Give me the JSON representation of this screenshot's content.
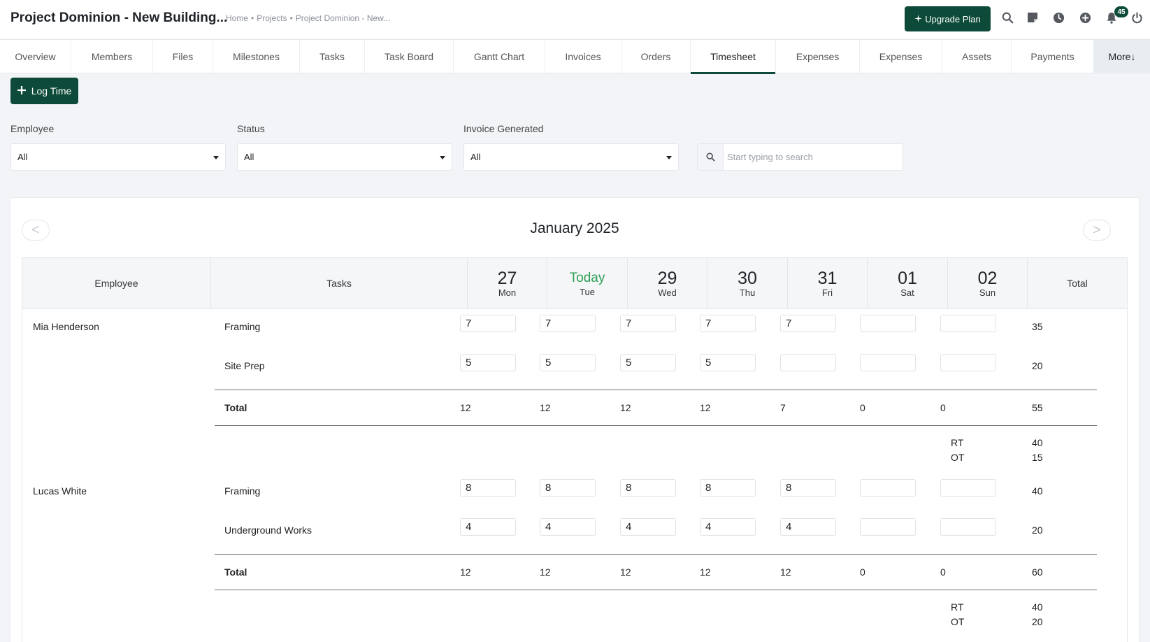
{
  "header": {
    "title": "Project Dominion - New Building...",
    "breadcrumb": [
      "Home",
      "Projects",
      "Project Dominion - New..."
    ],
    "upgrade_label": "Upgrade Plan",
    "notification_count": "45",
    "icons": [
      "search-icon",
      "sticky-note-icon",
      "clock-icon",
      "plus-circle-icon",
      "bell-icon",
      "power-icon"
    ],
    "accent_color": "#0d4a3a"
  },
  "tabs": [
    {
      "label": "Overview"
    },
    {
      "label": "Members"
    },
    {
      "label": "Files"
    },
    {
      "label": "Milestones"
    },
    {
      "label": "Tasks"
    },
    {
      "label": "Task Board"
    },
    {
      "label": "Gantt Chart"
    },
    {
      "label": "Invoices"
    },
    {
      "label": "Orders"
    },
    {
      "label": "Timesheet"
    },
    {
      "label": "Expenses"
    },
    {
      "label": "Expenses"
    },
    {
      "label": "Assets"
    },
    {
      "label": "Payments"
    },
    {
      "label": "More↓"
    }
  ],
  "active_tab": "Timesheet",
  "actions": {
    "log_time_label": "Log Time"
  },
  "filters": {
    "employee": {
      "label": "Employee",
      "value": "All"
    },
    "status": {
      "label": "Status",
      "value": "All"
    },
    "invoice": {
      "label": "Invoice Generated",
      "value": "All"
    },
    "search_placeholder": "Start typing to search"
  },
  "calendar": {
    "month": "January 2025",
    "prev": "<",
    "next": ">",
    "col_employee": "Employee",
    "col_tasks": "Tasks",
    "col_total": "Total",
    "days": [
      {
        "num": "27",
        "name": "Mon"
      },
      {
        "num": "Today",
        "name": "Tue",
        "today": true
      },
      {
        "num": "29",
        "name": "Wed"
      },
      {
        "num": "30",
        "name": "Thu"
      },
      {
        "num": "31",
        "name": "Fri"
      },
      {
        "num": "01",
        "name": "Sat"
      },
      {
        "num": "02",
        "name": "Sun"
      }
    ],
    "today_color": "#2e9e54"
  },
  "employees": [
    {
      "name": "Mia Henderson",
      "tasks": [
        {
          "name": "Framing",
          "hours": [
            "7",
            "7",
            "7",
            "7",
            "7",
            "",
            ""
          ],
          "total": "35"
        },
        {
          "name": "Site Prep",
          "hours": [
            "5",
            "5",
            "5",
            "5",
            "",
            "",
            ""
          ],
          "total": "20"
        }
      ],
      "total_label": "Total",
      "daily_totals": [
        "12",
        "12",
        "12",
        "12",
        "7",
        "0",
        "0"
      ],
      "grand_total": "55",
      "rt_label": "RT",
      "rt": "40",
      "ot_label": "OT",
      "ot": "15"
    },
    {
      "name": "Lucas White",
      "tasks": [
        {
          "name": "Framing",
          "hours": [
            "8",
            "8",
            "8",
            "8",
            "8",
            "",
            ""
          ],
          "total": "40"
        },
        {
          "name": "Underground Works",
          "hours": [
            "4",
            "4",
            "4",
            "4",
            "4",
            "",
            ""
          ],
          "total": "20"
        }
      ],
      "total_label": "Total",
      "daily_totals": [
        "12",
        "12",
        "12",
        "12",
        "12",
        "0",
        "0"
      ],
      "grand_total": "60",
      "rt_label": "RT",
      "rt": "40",
      "ot_label": "OT",
      "ot": "20"
    }
  ]
}
